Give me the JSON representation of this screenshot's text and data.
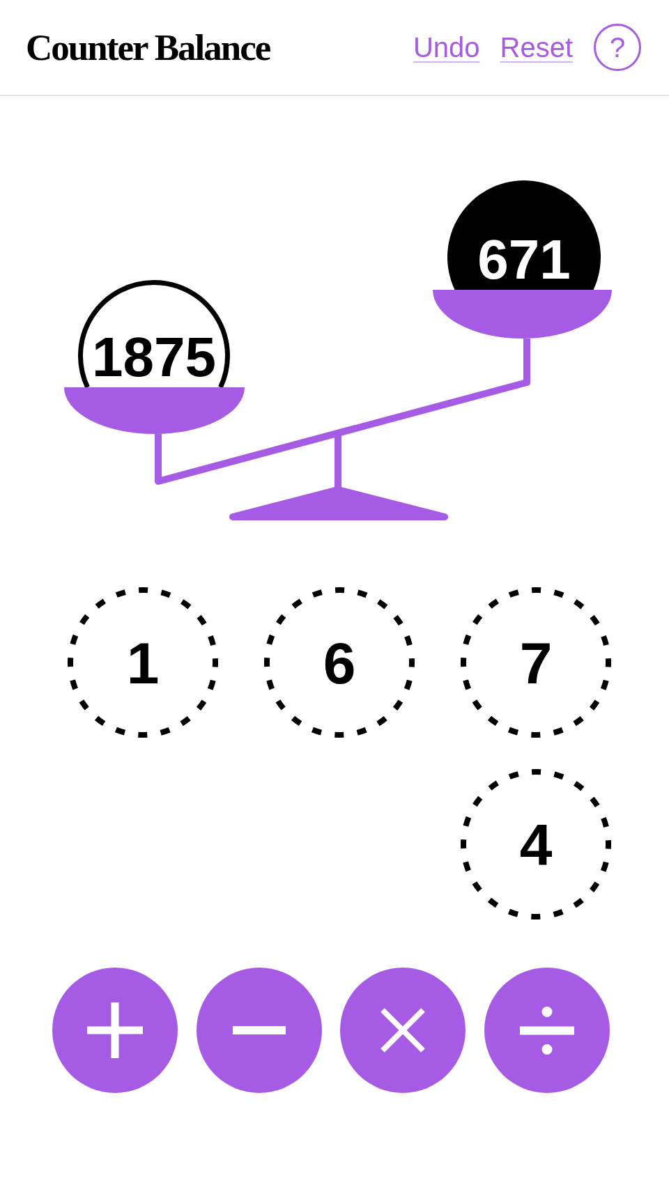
{
  "header": {
    "title": "Counter Balance",
    "links": [
      {
        "label": "Undo"
      },
      {
        "label": "Reset"
      }
    ],
    "help_button": {
      "label": "?"
    }
  },
  "scale": {
    "weights": [
      {
        "value": "1875",
        "highlighted": false
      },
      {
        "value": "671",
        "highlighted": true
      }
    ]
  },
  "tiles": [
    {
      "value": "1"
    },
    {
      "value": "6"
    },
    {
      "value": "7"
    },
    {
      "value": "4"
    }
  ],
  "operators": [
    {
      "kind": "add"
    },
    {
      "kind": "subtract"
    },
    {
      "kind": "multiply"
    },
    {
      "kind": "divide"
    }
  ]
}
